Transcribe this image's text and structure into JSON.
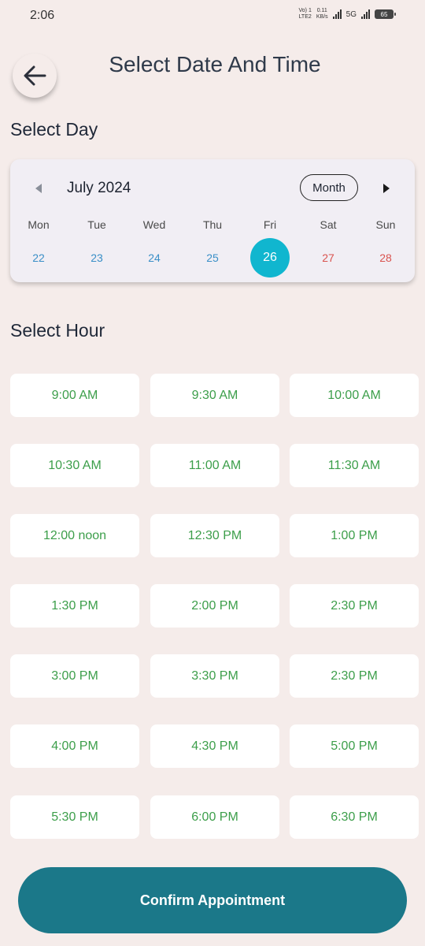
{
  "status": {
    "time": "2:06",
    "lte_top": "Vo) 1",
    "lte_bottom": "LTE2",
    "speed_top": "0.11",
    "speed_bottom": "KB/s",
    "network": "5G",
    "battery": "65"
  },
  "header": {
    "title": "Select Date And Time",
    "back_icon": "arrow-left-icon"
  },
  "day_section": {
    "title": "Select Day",
    "month_label": "July 2024",
    "mode_button": "Month",
    "weekdays": [
      "Mon",
      "Tue",
      "Wed",
      "Thu",
      "Fri",
      "Sat",
      "Sun"
    ],
    "days": [
      "22",
      "23",
      "24",
      "25",
      "26",
      "27",
      "28"
    ],
    "selected_day": "26",
    "accent_color": "#10b6cf"
  },
  "hour_section": {
    "title": "Select Hour",
    "slots": [
      "9:00 AM",
      "9:30 AM",
      "10:00 AM",
      "10:30 AM",
      "11:00 AM",
      "11:30 AM",
      "12:00 noon",
      "12:30 PM",
      "1:00 PM",
      "1:30 PM",
      "2:00 PM",
      "2:30 PM",
      "3:00 PM",
      "3:30 PM",
      "2:30 PM",
      "4:00 PM",
      "4:30 PM",
      "5:00 PM",
      "5:30 PM",
      "6:00 PM",
      "6:30 PM"
    ],
    "slot_text_color": "#3c9e4a"
  },
  "confirm_button": {
    "label": "Confirm Appointment",
    "color": "#1b7889"
  }
}
